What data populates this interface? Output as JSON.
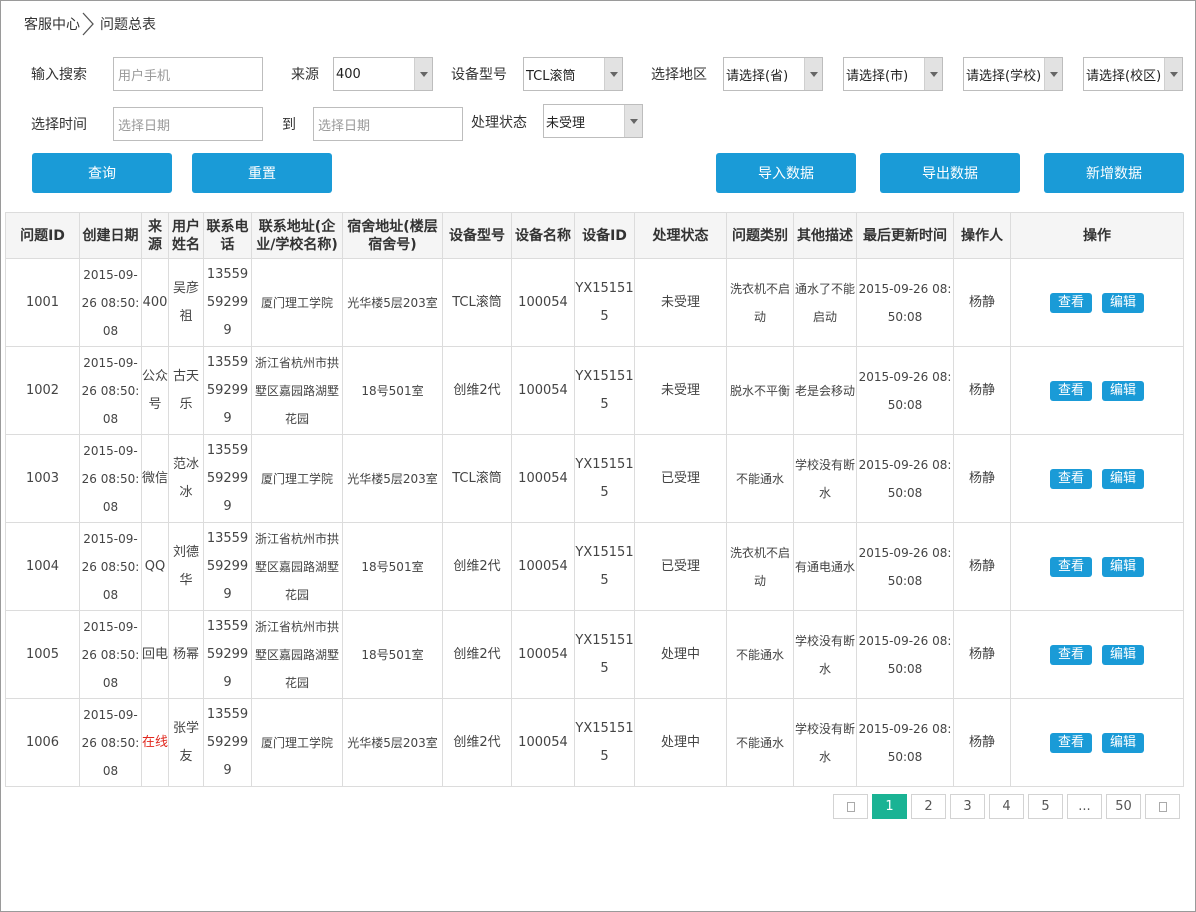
{
  "breadcrumb": {
    "root": "客服中心",
    "current": "问题总表"
  },
  "filters": {
    "search_label": "输入搜索",
    "search_placeholder": "用户手机",
    "source_label": "来源",
    "source_value": "400",
    "model_label": "设备型号",
    "model_value": "TCL滚筒",
    "region_label": "选择地区",
    "province_value": "请选择(省)",
    "city_value": "请选择(市)",
    "school_value": "请选择(学校)",
    "campus_value": "请选择(校区)",
    "time_label": "选择时间",
    "date_placeholder": "选择日期",
    "to_label": "到",
    "status_label": "处理状态",
    "status_value": "未受理"
  },
  "buttons": {
    "query": "查询",
    "reset": "重置",
    "import": "导入数据",
    "export": "导出数据",
    "add": "新增数据"
  },
  "table": {
    "headers": [
      "问题ID",
      "创建日期",
      "来源",
      "用户姓名",
      "联系电话",
      "联系地址(企业/学校名称)",
      "宿舍地址(楼层宿舍号)",
      "设备型号",
      "设备名称",
      "设备ID",
      "处理状态",
      "问题类别",
      "其他描述",
      "最后更新时间",
      "操作人",
      "操作"
    ],
    "view_label": "查看",
    "edit_label": "编辑",
    "rows": [
      {
        "id": "1001",
        "created": "2015-09-26 08:50:08",
        "source": "400",
        "name": "吴彦祖",
        "phone": "13559592999",
        "address": "厦门理工学院",
        "dorm": "光华楼5层203室",
        "model": "TCL滚筒",
        "device_name": "100054",
        "device_id": "YX151515",
        "status": "未受理",
        "category": "洗衣机不启动",
        "desc": "通水了不能启动",
        "updated": "2015-09-26 08:50:08",
        "operator": "杨静"
      },
      {
        "id": "1002",
        "created": "2015-09-26 08:50:08",
        "source": "公众号",
        "name": "古天乐",
        "phone": "13559592999",
        "address": "浙江省杭州市拱墅区嘉园路湖墅花园",
        "dorm": "18号501室",
        "model": "创维2代",
        "device_name": "100054",
        "device_id": "YX151515",
        "status": "未受理",
        "category": "脱水不平衡",
        "desc": "老是会移动",
        "updated": "2015-09-26 08:50:08",
        "operator": "杨静"
      },
      {
        "id": "1003",
        "created": "2015-09-26 08:50:08",
        "source": "微信",
        "name": "范冰冰",
        "phone": "13559592999",
        "address": "厦门理工学院",
        "dorm": "光华楼5层203室",
        "model": "TCL滚筒",
        "device_name": "100054",
        "device_id": "YX151515",
        "status": "已受理",
        "category": "不能通水",
        "desc": "学校没有断水",
        "updated": "2015-09-26 08:50:08",
        "operator": "杨静"
      },
      {
        "id": "1004",
        "created": "2015-09-26 08:50:08",
        "source": "QQ",
        "name": "刘德华",
        "phone": "13559592999",
        "address": "浙江省杭州市拱墅区嘉园路湖墅花园",
        "dorm": "18号501室",
        "model": "创维2代",
        "device_name": "100054",
        "device_id": "YX151515",
        "status": "已受理",
        "category": "洗衣机不启动",
        "desc": "有通电通水",
        "updated": "2015-09-26 08:50:08",
        "operator": "杨静"
      },
      {
        "id": "1005",
        "created": "2015-09-26 08:50:08",
        "source": "回电",
        "name": "杨幂",
        "phone": "13559592999",
        "address": "浙江省杭州市拱墅区嘉园路湖墅花园",
        "dorm": "18号501室",
        "model": "创维2代",
        "device_name": "100054",
        "device_id": "YX151515",
        "status": "处理中",
        "category": "不能通水",
        "desc": "学校没有断水",
        "updated": "2015-09-26 08:50:08",
        "operator": "杨静"
      },
      {
        "id": "1006",
        "created": "2015-09-26 08:50:08",
        "source": "在线",
        "source_color": "#e0281e",
        "name": "张学友",
        "phone": "13559592999",
        "address": "厦门理工学院",
        "dorm": "光华楼5层203室",
        "model": "创维2代",
        "device_name": "100054",
        "device_id": "YX151515",
        "status": "处理中",
        "category": "不能通水",
        "desc": "学校没有断水",
        "updated": "2015-09-26 08:50:08",
        "operator": "杨静"
      }
    ]
  },
  "pagination": {
    "pages": [
      "1",
      "2",
      "3",
      "4",
      "5",
      "...",
      "50"
    ],
    "current": "1"
  },
  "colors": {
    "primary": "#1a9bd7",
    "pager_active": "#1ab394",
    "highlight": "#e0281e"
  }
}
